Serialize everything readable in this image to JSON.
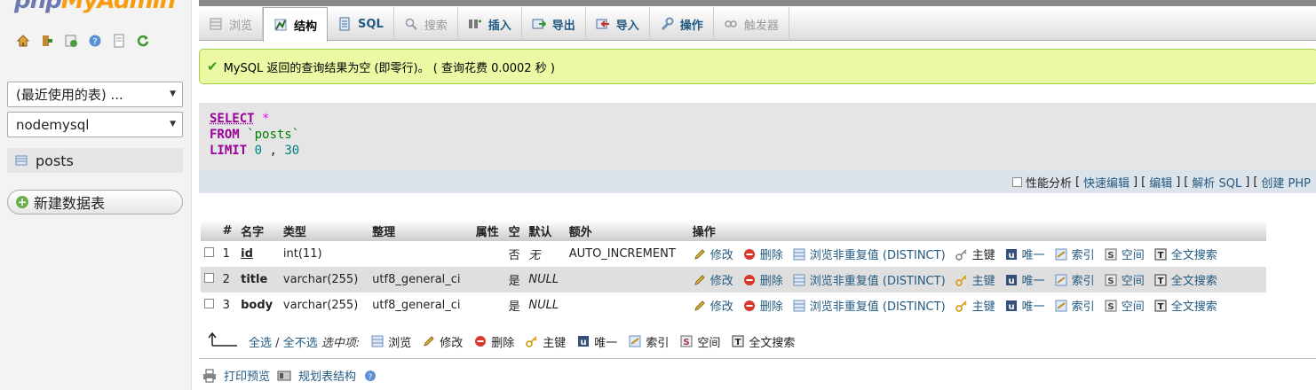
{
  "nav": {
    "logo_part1": "php",
    "logo_part2": "MyAdmin",
    "recent_select": "(最近使用的表) ...",
    "db_select": "nodemysql",
    "table_item": "posts",
    "new_table": "新建数据表"
  },
  "tabs": [
    {
      "label": "浏览",
      "icon": "browse-icon",
      "state": "disabled"
    },
    {
      "label": "结构",
      "icon": "structure-icon",
      "state": "active"
    },
    {
      "label": "SQL",
      "icon": "sql-icon",
      "state": "normal"
    },
    {
      "label": "搜索",
      "icon": "search-icon",
      "state": "disabled"
    },
    {
      "label": "插入",
      "icon": "insert-icon",
      "state": "normal"
    },
    {
      "label": "导出",
      "icon": "export-icon",
      "state": "normal"
    },
    {
      "label": "导入",
      "icon": "import-icon",
      "state": "normal"
    },
    {
      "label": "操作",
      "icon": "wrench-icon",
      "state": "normal"
    },
    {
      "label": "触发器",
      "icon": "trigger-icon",
      "state": "disabled"
    }
  ],
  "message": "MySQL 返回的查询结果为空 (即零行)。 ( 查询花费 0.0002 秒 )",
  "sql": {
    "kw_select": "SELECT",
    "star": "*",
    "kw_from": "FROM",
    "table": "`posts`",
    "kw_limit": "LIMIT",
    "limit_start": "0",
    "limit_sep": ",",
    "limit_count": "30"
  },
  "sql_actions": {
    "profiling": "性能分析",
    "quick_edit": "快速编辑",
    "edit": "编辑",
    "explain": "解析 SQL",
    "create_php": "创建 PHP"
  },
  "table": {
    "headers": [
      "#",
      "名字",
      "类型",
      "整理",
      "属性",
      "空",
      "默认",
      "额外",
      "操作"
    ],
    "rows": [
      {
        "num": "1",
        "name": "id",
        "type": "int(11)",
        "collation": "",
        "attributes": "",
        "null": "否",
        "default": "无",
        "extra": "AUTO_INCREMENT",
        "pk": true
      },
      {
        "num": "2",
        "name": "title",
        "type": "varchar(255)",
        "collation": "utf8_general_ci",
        "attributes": "",
        "null": "是",
        "default": "NULL",
        "extra": "",
        "pk": false
      },
      {
        "num": "3",
        "name": "body",
        "type": "varchar(255)",
        "collation": "utf8_general_ci",
        "attributes": "",
        "null": "是",
        "default": "NULL",
        "extra": "",
        "pk": false
      }
    ],
    "row_actions": {
      "edit": "修改",
      "drop": "删除",
      "distinct": "浏览非重复值 (DISTINCT)",
      "primary": "主键",
      "unique": "唯一",
      "index": "索引",
      "spatial": "空间",
      "fulltext": "全文搜索"
    }
  },
  "bulk": {
    "check_all": "全选",
    "sep": "/",
    "uncheck_all": "全不选",
    "with_selected": "选中项:",
    "browse": "浏览",
    "edit": "修改",
    "drop": "删除",
    "primary": "主键",
    "unique": "唯一",
    "index": "索引",
    "spatial": "空间",
    "fulltext": "全文搜索"
  },
  "footer": {
    "print": "打印预览",
    "propose": "规划表结构"
  },
  "colors": {
    "link": "#235a81",
    "success_bg": "#ebf8a4",
    "sql_keyword": "#990099"
  }
}
